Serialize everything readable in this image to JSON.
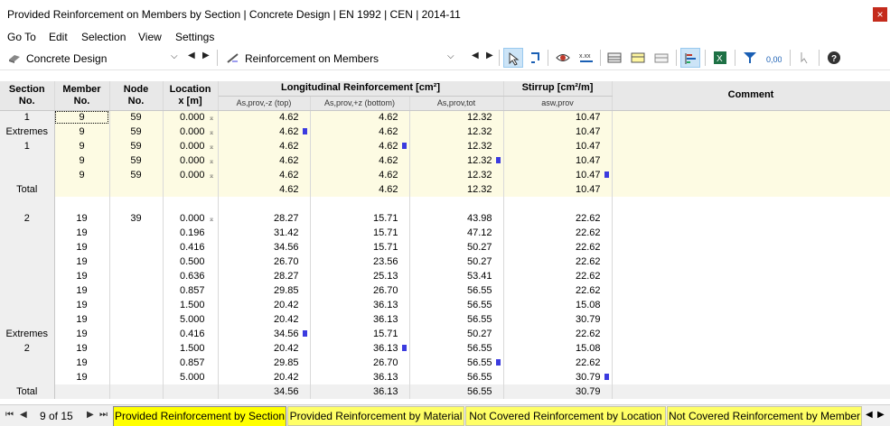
{
  "window": {
    "title": "Provided Reinforcement on Members by Section | Concrete Design | EN 1992 | CEN | 2014-11",
    "close_glyph": "×"
  },
  "menu": [
    "Go To",
    "Edit",
    "Selection",
    "View",
    "Settings"
  ],
  "toolbar": {
    "module_combo": "Concrete Design",
    "result_combo": "Reinforcement on Members"
  },
  "table": {
    "headers": {
      "section": "Section\nNo.",
      "member": "Member\nNo.",
      "node": "Node\nNo.",
      "location": "Location\nx [m]",
      "long_group": "Longitudinal Reinforcement [cm²]",
      "stirrup_group": "Stirrup [cm²/m]",
      "comment": "Comment",
      "as_top": "As,prov,-z (top)",
      "as_bottom": "As,prov,+z (bottom)",
      "as_tot": "As,prov,tot",
      "asw": "asw,prov"
    },
    "rows": [
      {
        "sec": "1",
        "member": "9",
        "node": "59",
        "loc": "0.000",
        "lm": true,
        "top": "4.62",
        "bot": "4.62",
        "tot": "12.32",
        "asw": "10.47",
        "mk": "",
        "yellow": true,
        "sel": true
      },
      {
        "sec": "Extremes",
        "member": "9",
        "node": "59",
        "loc": "0.000",
        "lm": true,
        "top": "4.62",
        "bot": "4.62",
        "tot": "12.32",
        "asw": "10.47",
        "mk": "top",
        "yellow": true
      },
      {
        "sec": "1",
        "member": "9",
        "node": "59",
        "loc": "0.000",
        "lm": true,
        "top": "4.62",
        "bot": "4.62",
        "tot": "12.32",
        "asw": "10.47",
        "mk": "bot",
        "yellow": true
      },
      {
        "sec": "",
        "member": "9",
        "node": "59",
        "loc": "0.000",
        "lm": true,
        "top": "4.62",
        "bot": "4.62",
        "tot": "12.32",
        "asw": "10.47",
        "mk": "tot",
        "yellow": true
      },
      {
        "sec": "",
        "member": "9",
        "node": "59",
        "loc": "0.000",
        "lm": true,
        "top": "4.62",
        "bot": "4.62",
        "tot": "12.32",
        "asw": "10.47",
        "mk": "asw",
        "yellow": true
      },
      {
        "sec": "Total",
        "member": "",
        "node": "",
        "loc": "",
        "lm": false,
        "top": "4.62",
        "bot": "4.62",
        "tot": "12.32",
        "asw": "10.47",
        "mk": "",
        "yellow": true,
        "total": true
      },
      {
        "blank": true
      },
      {
        "sec": "2",
        "member": "19",
        "node": "39",
        "loc": "0.000",
        "lm": true,
        "top": "28.27",
        "bot": "15.71",
        "tot": "43.98",
        "asw": "22.62",
        "mk": ""
      },
      {
        "sec": "",
        "member": "19",
        "node": "",
        "loc": "0.196",
        "lm": false,
        "top": "31.42",
        "bot": "15.71",
        "tot": "47.12",
        "asw": "22.62",
        "mk": ""
      },
      {
        "sec": "",
        "member": "19",
        "node": "",
        "loc": "0.416",
        "lm": false,
        "top": "34.56",
        "bot": "15.71",
        "tot": "50.27",
        "asw": "22.62",
        "mk": ""
      },
      {
        "sec": "",
        "member": "19",
        "node": "",
        "loc": "0.500",
        "lm": false,
        "top": "26.70",
        "bot": "23.56",
        "tot": "50.27",
        "asw": "22.62",
        "mk": ""
      },
      {
        "sec": "",
        "member": "19",
        "node": "",
        "loc": "0.636",
        "lm": false,
        "top": "28.27",
        "bot": "25.13",
        "tot": "53.41",
        "asw": "22.62",
        "mk": ""
      },
      {
        "sec": "",
        "member": "19",
        "node": "",
        "loc": "0.857",
        "lm": false,
        "top": "29.85",
        "bot": "26.70",
        "tot": "56.55",
        "asw": "22.62",
        "mk": ""
      },
      {
        "sec": "",
        "member": "19",
        "node": "",
        "loc": "1.500",
        "lm": false,
        "top": "20.42",
        "bot": "36.13",
        "tot": "56.55",
        "asw": "15.08",
        "mk": ""
      },
      {
        "sec": "",
        "member": "19",
        "node": "",
        "loc": "5.000",
        "lm": false,
        "top": "20.42",
        "bot": "36.13",
        "tot": "56.55",
        "asw": "30.79",
        "mk": ""
      },
      {
        "sec": "Extremes",
        "member": "19",
        "node": "",
        "loc": "0.416",
        "lm": false,
        "top": "34.56",
        "bot": "15.71",
        "tot": "50.27",
        "asw": "22.62",
        "mk": "top"
      },
      {
        "sec": "2",
        "member": "19",
        "node": "",
        "loc": "1.500",
        "lm": false,
        "top": "20.42",
        "bot": "36.13",
        "tot": "56.55",
        "asw": "15.08",
        "mk": "bot"
      },
      {
        "sec": "",
        "member": "19",
        "node": "",
        "loc": "0.857",
        "lm": false,
        "top": "29.85",
        "bot": "26.70",
        "tot": "56.55",
        "asw": "22.62",
        "mk": "tot"
      },
      {
        "sec": "",
        "member": "19",
        "node": "",
        "loc": "5.000",
        "lm": false,
        "top": "20.42",
        "bot": "36.13",
        "tot": "56.55",
        "asw": "30.79",
        "mk": "asw"
      },
      {
        "sec": "Total",
        "member": "",
        "node": "",
        "loc": "",
        "lm": false,
        "top": "34.56",
        "bot": "36.13",
        "tot": "56.55",
        "asw": "30.79",
        "mk": "",
        "total": true
      }
    ],
    "location_marker_glyph": "⌅"
  },
  "statusbar": {
    "page": "9 of 15",
    "tabs": [
      "Provided Reinforcement by Section",
      "Provided Reinforcement by Material",
      "Not Covered Reinforcement by Location",
      "Not Covered Reinforcement by Member"
    ],
    "active_tab": 0
  },
  "colors": {
    "yellow_row": "#fdfbe3",
    "tab_yellow": "#ffff00",
    "marker_blue": "#3b3bdf"
  }
}
